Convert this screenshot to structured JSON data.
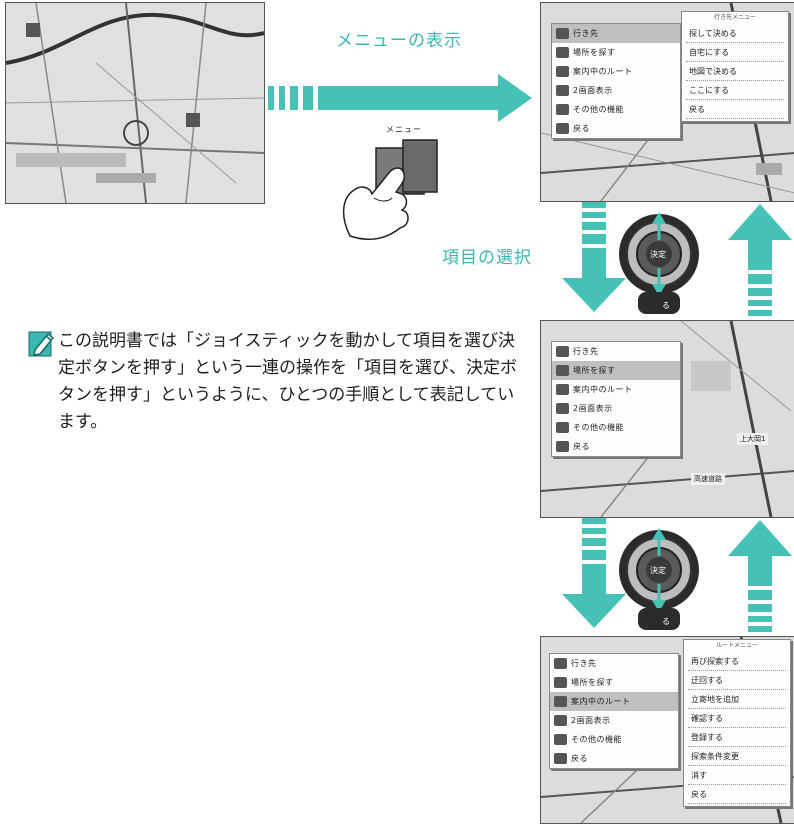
{
  "labels": {
    "menu_display": "メニューの表示",
    "item_select": "項目の選択",
    "menu_button": "メニュー",
    "ketei": "決定",
    "modoru": "る"
  },
  "note": {
    "text": "この説明書では「ジョイスティックを動かして項目を選び決定ボタンを押す」という一連の操作を「項目を選び、決定ボタンを押す」というように、ひとつの手順として表記しています。",
    "icon": "pencil-note-icon"
  },
  "screens": {
    "main_menu_items": [
      "行き先",
      "場所を探す",
      "案内中のルート",
      "2画面表示",
      "その他の機能",
      "戻る"
    ],
    "screen1": {
      "selected": 0,
      "submenu_header": "行き先メニュー",
      "submenu": [
        "探して決める",
        "自宅にする",
        "地図で決める",
        "ここにする",
        "戻る"
      ]
    },
    "screen2": {
      "selected": 1,
      "map_labels": [
        "高速道路",
        "上大岡1"
      ]
    },
    "screen3": {
      "selected": 2,
      "submenu_header": "ルートメニュー",
      "submenu": [
        "再び探索する",
        "迂回する",
        "立寄地を追加",
        "確認する",
        "登録する",
        "探索条件変更",
        "消す",
        "戻る"
      ]
    }
  },
  "colors": {
    "accent": "#38b8b0",
    "arrow": "#46c1b5"
  }
}
